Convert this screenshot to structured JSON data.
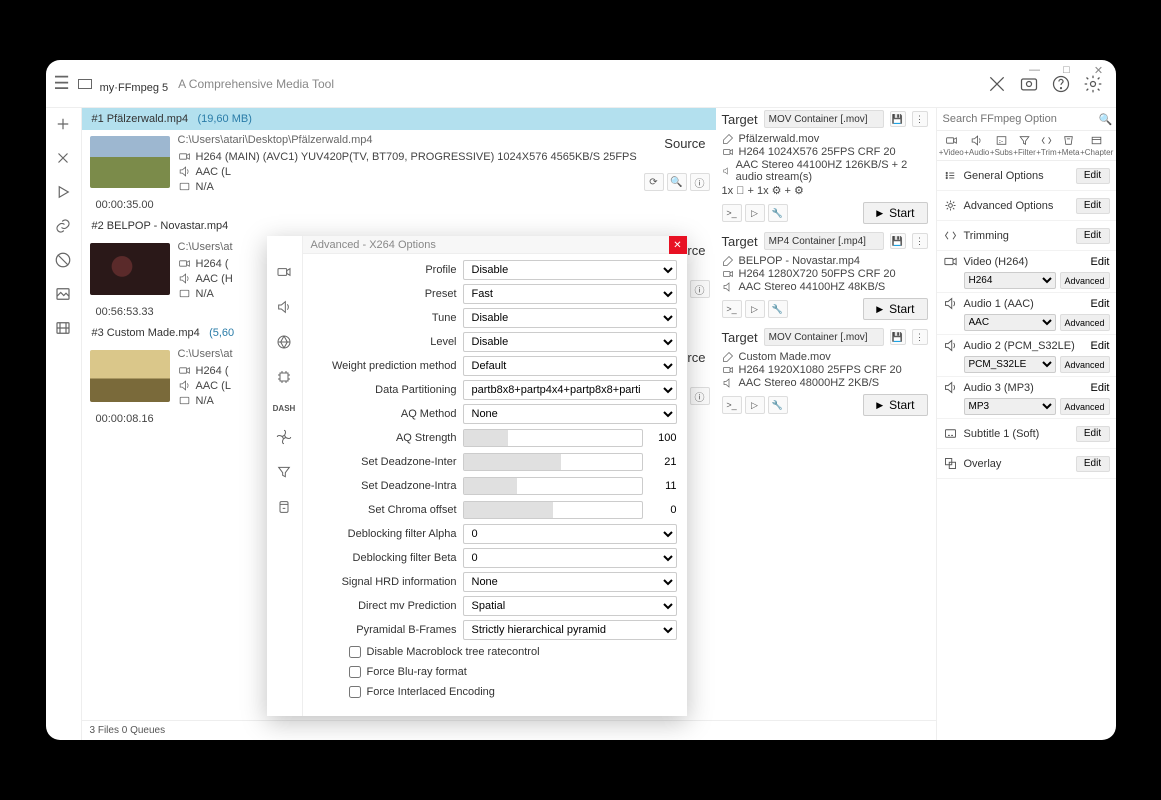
{
  "brand": {
    "pre": "my·",
    "mid": "FF",
    "suf": "mpeg ",
    "ver": "5",
    "tag": "A Comprehensive Media Tool"
  },
  "search": {
    "placeholder": "Search FFmpeg Option"
  },
  "addbtns": [
    "+Video",
    "+Audio",
    "+Subs",
    "+Filter",
    "+Trim",
    "+Meta",
    "+Chapter"
  ],
  "opts": {
    "general": "General Options",
    "advanced": "Advanced Options",
    "trimming": "Trimming",
    "overlay": "Overlay",
    "subtitle": "Subtitle 1 (Soft)",
    "edit": "Edit",
    "adv": "Advanced"
  },
  "streams": {
    "video": {
      "label": "Video (H264)",
      "codec": "H264"
    },
    "a1": {
      "label": "Audio 1 (AAC)",
      "codec": "AAC"
    },
    "a2": {
      "label": "Audio 2 (PCM_S32LE)",
      "codec": "PCM_S32LE"
    },
    "a3": {
      "label": "Audio 3 (MP3)",
      "codec": "MP3"
    }
  },
  "files": [
    {
      "hdr": "#1  Pfälzerwald.mp4",
      "size": "(19,60 MB)",
      "path": "C:\\Users\\atari\\Desktop\\Pfälzerwald.mp4",
      "v": "H264 (MAIN) (AVC1)  YUV420P(TV, BT709, PROGRESSIVE) 1024X576  4565KB/S 25FPS",
      "a": "AAC (L",
      "s": "N/A",
      "dur": "00:00:35.00",
      "thumb": "t1"
    },
    {
      "hdr": "#2  BELPOP  - Novastar.mp4",
      "size": "",
      "path": "C:\\Users\\at",
      "v": "H264 (",
      "a": "AAC (H",
      "s": "N/A",
      "dur": "00:56:53.33",
      "thumb": "t2"
    },
    {
      "hdr": "#3  Custom Made.mp4",
      "size": "(5,60",
      "path": "C:\\Users\\at",
      "v": "H264 (",
      "a": "AAC (L",
      "s": "N/A",
      "dur": "00:00:08.16",
      "thumb": "t3"
    }
  ],
  "srclabel": "Source",
  "targets": [
    {
      "container": "MOV Container [.mov]",
      "name": "Pfälzerwald.mov",
      "v": "H264 1024X576 25FPS CRF 20",
      "a": "AAC Stereo 44100HZ 126KB/S + 2 audio stream(s)",
      "extra": "1x ⃞  + 1x ⚙ + ⚙",
      "start": "Start"
    },
    {
      "container": "MP4 Container [.mp4]",
      "name": "BELPOP  - Novastar.mp4",
      "v": "H264 1280X720 50FPS CRF 20",
      "a": "AAC Stereo 44100HZ 48KB/S",
      "extra": "",
      "start": "Start"
    },
    {
      "container": "MOV Container [.mov]",
      "name": "Custom Made.mov",
      "v": "H264 1920X1080 25FPS CRF 20",
      "a": "AAC Stereo 48000HZ 2KB/S",
      "extra": "",
      "start": "Start"
    }
  ],
  "tgtlabel": "Target",
  "status": "3 Files 0 Queues",
  "modal": {
    "title": "Advanced - X264 Options",
    "rows": [
      {
        "t": "sel",
        "l": "Profile",
        "v": "Disable"
      },
      {
        "t": "sel",
        "l": "Preset",
        "v": "Fast"
      },
      {
        "t": "sel",
        "l": "Tune",
        "v": "Disable"
      },
      {
        "t": "sel",
        "l": "Level",
        "v": "Disable"
      },
      {
        "t": "sel",
        "l": "Weight prediction method",
        "v": "Default"
      },
      {
        "t": "sel",
        "l": "Data Partitioning",
        "v": "partb8x8+partp4x4+partp8x8+parti"
      },
      {
        "t": "sel",
        "l": "AQ Method",
        "v": "None"
      },
      {
        "t": "sld",
        "l": "AQ Strength",
        "v": "100",
        "p": 25
      },
      {
        "t": "sld",
        "l": "Set Deadzone-Inter",
        "v": "21",
        "p": 55
      },
      {
        "t": "sld",
        "l": "Set Deadzone-Intra",
        "v": "11",
        "p": 30
      },
      {
        "t": "sld",
        "l": "Set Chroma offset",
        "v": "0",
        "p": 50
      },
      {
        "t": "sel",
        "l": "Deblocking filter Alpha",
        "v": "0"
      },
      {
        "t": "sel",
        "l": "Deblocking filter Beta",
        "v": "0"
      },
      {
        "t": "sel",
        "l": "Signal HRD information",
        "v": "None"
      },
      {
        "t": "sel",
        "l": "Direct mv Prediction",
        "v": "Spatial"
      },
      {
        "t": "sel",
        "l": "Pyramidal B-Frames",
        "v": "Strictly hierarchical pyramid"
      }
    ],
    "checks": [
      "Disable Macroblock tree ratecontrol",
      "Force Blu-ray format",
      "Force Interlaced Encoding"
    ]
  }
}
